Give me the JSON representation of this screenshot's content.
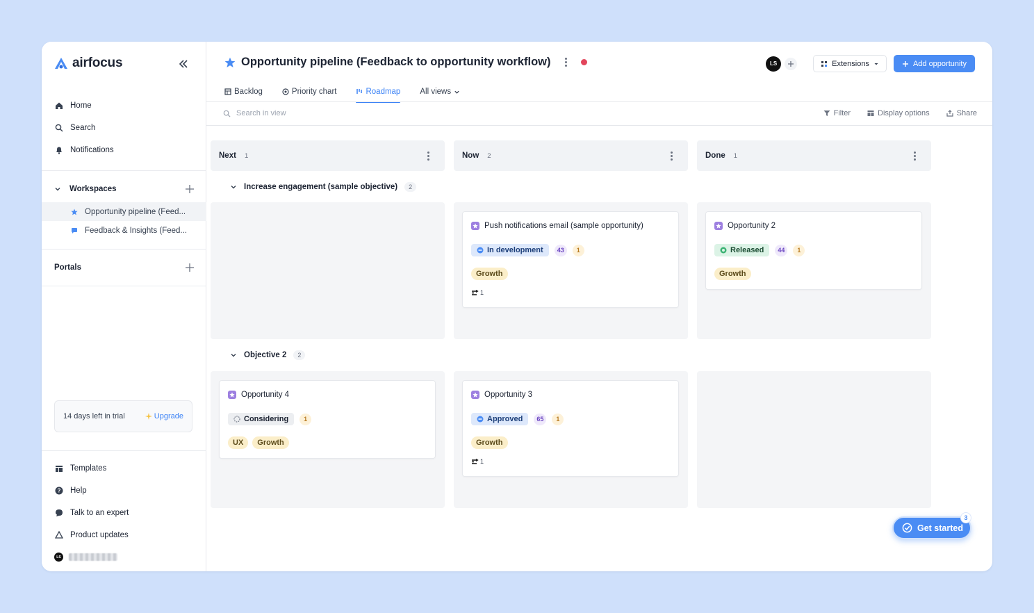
{
  "brand": {
    "name": "airfocus"
  },
  "sidebar": {
    "nav": [
      {
        "label": "Home",
        "icon": "home-icon"
      },
      {
        "label": "Search",
        "icon": "search-icon"
      },
      {
        "label": "Notifications",
        "icon": "bell-icon"
      }
    ],
    "workspaces_label": "Workspaces",
    "workspaces": [
      {
        "label": "Opportunity pipeline (Feed...",
        "icon": "star-icon",
        "active": true
      },
      {
        "label": "Feedback & Insights (Feed...",
        "icon": "chat-icon",
        "active": false
      }
    ],
    "portals_label": "Portals",
    "trial": {
      "text": "14 days left in trial",
      "upgrade": "Upgrade"
    },
    "bottom": [
      {
        "label": "Templates",
        "icon": "templates-icon"
      },
      {
        "label": "Help",
        "icon": "help-icon"
      },
      {
        "label": "Talk to an expert",
        "icon": "chat-bubble-icon"
      },
      {
        "label": "Product updates",
        "icon": "product-updates-icon"
      }
    ],
    "user_initials": "LS"
  },
  "header": {
    "title": "Opportunity pipeline (Feedback to opportunity workflow)",
    "avatar_initials": "LS",
    "extensions_label": "Extensions",
    "add_label": "Add opportunity"
  },
  "tabs": [
    {
      "label": "Backlog",
      "icon": "table-icon",
      "active": false
    },
    {
      "label": "Priority chart",
      "icon": "target-icon",
      "active": false
    },
    {
      "label": "Roadmap",
      "icon": "roadmap-icon",
      "active": true
    },
    {
      "label": "All views",
      "icon": "chevron-down-icon",
      "active": false
    }
  ],
  "toolbar": {
    "search_placeholder": "Search in view",
    "filter": "Filter",
    "display": "Display options",
    "share": "Share"
  },
  "columns": [
    {
      "name": "Next",
      "count": "1"
    },
    {
      "name": "Now",
      "count": "2"
    },
    {
      "name": "Done",
      "count": "1"
    }
  ],
  "groups": [
    {
      "name": "Increase engagement (sample objective)",
      "count": "2"
    },
    {
      "name": "Objective 2",
      "count": "2"
    }
  ],
  "cards": {
    "push": {
      "title": "Push notifications email (sample opportunity)",
      "status": "In development",
      "score": "43",
      "num": "1",
      "tags": [
        "Growth"
      ],
      "links": "1"
    },
    "opp2": {
      "title": "Opportunity 2",
      "status": "Released",
      "score": "44",
      "num": "1",
      "tags": [
        "Growth"
      ]
    },
    "opp4": {
      "title": "Opportunity 4",
      "status": "Considering",
      "num": "1",
      "tags": [
        "UX",
        "Growth"
      ]
    },
    "opp3": {
      "title": "Opportunity 3",
      "status": "Approved",
      "score": "65",
      "num": "1",
      "tags": [
        "Growth"
      ],
      "links": "1"
    }
  },
  "get_started": {
    "label": "Get started",
    "badge": "3"
  },
  "colors": {
    "accent": "#4a8cf4",
    "record_dot": "#e2455b",
    "status_in_dev_bg": "#dde8fb",
    "status_released_bg": "#dcf3e6",
    "status_considering_bg": "#eceef1",
    "tag_bg": "#fbeec9",
    "opportunity_icon": "#9d7fe0"
  }
}
